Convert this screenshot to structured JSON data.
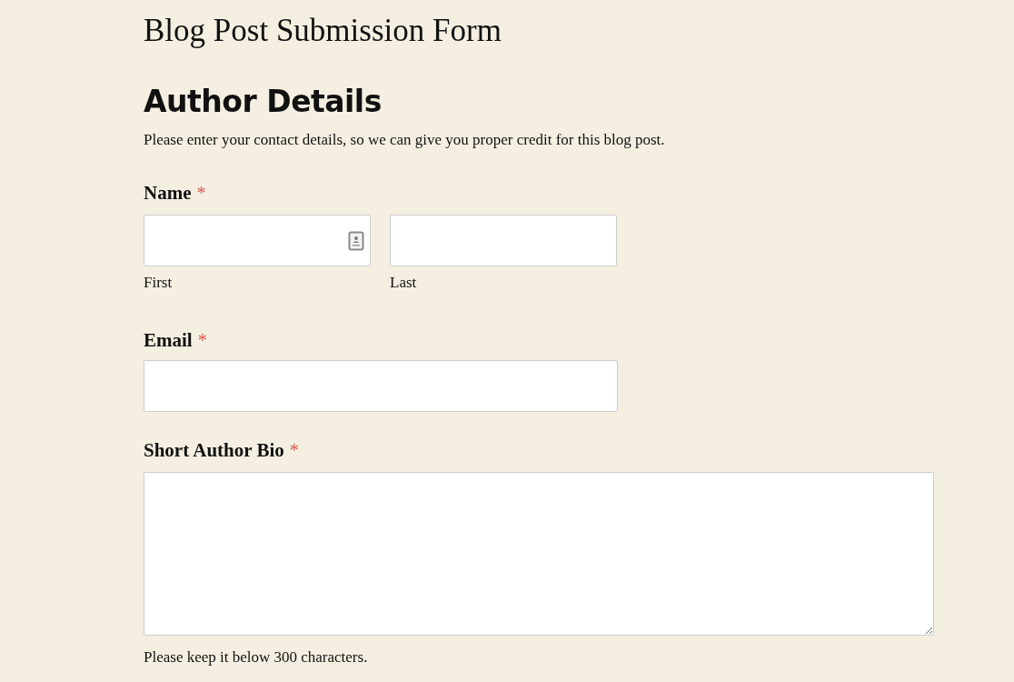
{
  "page_title": "Blog Post Submission Form",
  "section": {
    "heading": "Author Details",
    "description": "Please enter your contact details, so we can give you proper credit for this blog post."
  },
  "fields": [
    {
      "kind": "name",
      "label": "Name",
      "required_mark": "*",
      "parts": [
        {
          "sublabel": "First",
          "contact_icon": true
        },
        {
          "sublabel": "Last",
          "contact_icon": false
        }
      ]
    },
    {
      "kind": "email",
      "label": "Email",
      "required_mark": "*"
    },
    {
      "kind": "textarea",
      "label": "Short Author Bio",
      "required_mark": "*",
      "help": "Please keep it below 300 characters."
    }
  ]
}
